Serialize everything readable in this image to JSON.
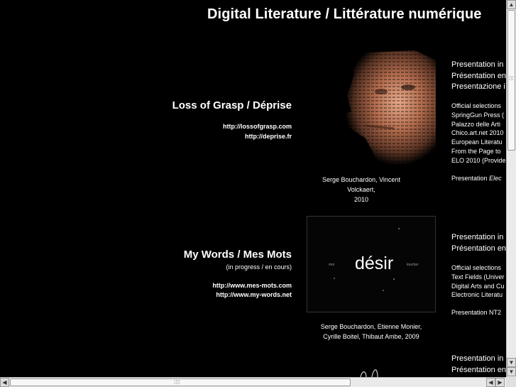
{
  "site": {
    "title": "Digital Literature / Littérature numérique"
  },
  "works": [
    {
      "title": "Loss of Grasp / Déprise",
      "status": "",
      "links": [
        "http://lossofgrasp.com",
        "http://deprise.fr"
      ],
      "credit_line1": "Serge Bouchardon, Vincent Volckaert,",
      "credit_line2": "2010",
      "pres": [
        "Presentation in",
        "Présentation en",
        "Presentazione i"
      ],
      "selections": [
        "Official selections",
        "SpringGun Press (",
        "Palazzo delle Arti",
        "Chico.art.net 2010",
        "European Literatu",
        "From the Page to",
        "ELO 2010 (Provide"
      ],
      "presentation_prefix": "Presentation",
      "presentation_italic": "Elec"
    },
    {
      "title": "My Words / Mes Mots",
      "status": "(in progress / en cours)",
      "links": [
        "http://www.mes-mots.com",
        "http://www.my-words.net"
      ],
      "credit_line1": "Serge Bouchardon, Etienne Monier,",
      "credit_line2": "Cyrille Boitel, Thibaut Ambe, 2009",
      "thumb_word": "désir",
      "thumb_small1": "moi",
      "thumb_small2": "toucher",
      "pres": [
        "Presentation in",
        "Présentation en"
      ],
      "selections": [
        "Official selections",
        "Text Fields (Univer",
        "Digital Arts and Cu",
        "Electronic Literatu"
      ],
      "presentation_line": "Presentation NT2"
    },
    {
      "pres": [
        "Presentation in",
        "Présentation en"
      ]
    }
  ],
  "colors": {
    "background": "#000000",
    "text": "#ffffff",
    "scrollbar": "#eaeaea"
  }
}
